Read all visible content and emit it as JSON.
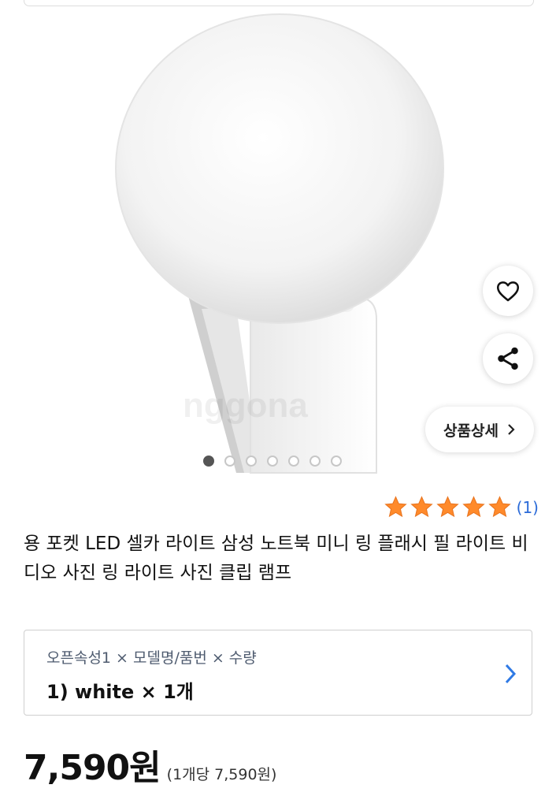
{
  "product": {
    "image_alt": "LED ring selfie light clip",
    "watermark": "nggona",
    "carousel": {
      "total": 7,
      "current": 1
    },
    "actions": {
      "wishlist_icon": "heart-outline-icon",
      "share_icon": "share-icon",
      "detail_label": "상품상세"
    },
    "rating": {
      "stars": 5,
      "max_stars": 5,
      "count_label": "(1)",
      "star_color": "#ff8a2b"
    },
    "title": "용 포켓 LED 셀카 라이트 삼성 노트북 미니 링 플래시 필 라이트 비디오 사진 링 라이트 사진 클립 램프"
  },
  "option": {
    "label": "오픈속성1 × 모델명/품번 × 수량",
    "value": "1) white × 1개"
  },
  "price": {
    "amount": "7,590원",
    "unit": "(1개당 7,590원)"
  },
  "colors": {
    "link_blue": "#2b6bd8",
    "chevron_blue": "#2f7ae5"
  }
}
